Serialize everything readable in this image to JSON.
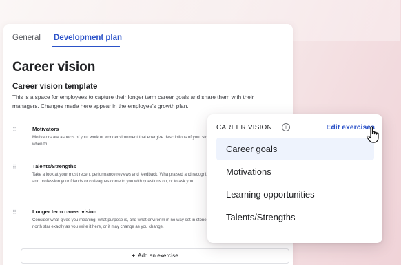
{
  "tabs": [
    {
      "label": "General",
      "active": false
    },
    {
      "label": "Development plan",
      "active": true
    }
  ],
  "main": {
    "title": "Career vision",
    "section_title": "Career vision template",
    "section_desc": "This is a space for employees to capture their longer term career goals and share them with their managers. Changes made here appear in the employee's growth plan.",
    "exercises": [
      {
        "title": "Motivators",
        "desc": "Motivators are aspects of your work or work environment that energize descriptions of your strongest drivers — what keeps you going when th"
      },
      {
        "title": "Talents/Strengths",
        "desc": "Take a look at your most recent performance reviews and feedback. Wha praised and recognized for? Think back to your personal and profession your friends or colleagues come to you with questions on, or to ask you"
      },
      {
        "title": "Longer term career vision",
        "desc": "Consider what gives you meaning, what purpose is, and what environm in no way set in stone but, rather, a way for you to establish a north star exactly as you write it here, or it may change as you change."
      }
    ],
    "add_button": {
      "icon": "+",
      "label": "Add an exercise"
    }
  },
  "popover": {
    "title": "CAREER VISION",
    "info_icon": "i",
    "edit_link": "Edit exercises",
    "items": [
      {
        "label": "Career goals",
        "selected": true
      },
      {
        "label": "Motivations",
        "selected": false
      },
      {
        "label": "Learning opportunities",
        "selected": false
      },
      {
        "label": "Talents/Strengths",
        "selected": false
      }
    ]
  },
  "colors": {
    "accent": "#2b52c8",
    "selected_bg": "#eef3fd",
    "background": "#f7ecec"
  },
  "icons": {
    "drag": "drag-handle-icon",
    "info": "info-icon",
    "cursor": "hand-pointer-cursor"
  }
}
